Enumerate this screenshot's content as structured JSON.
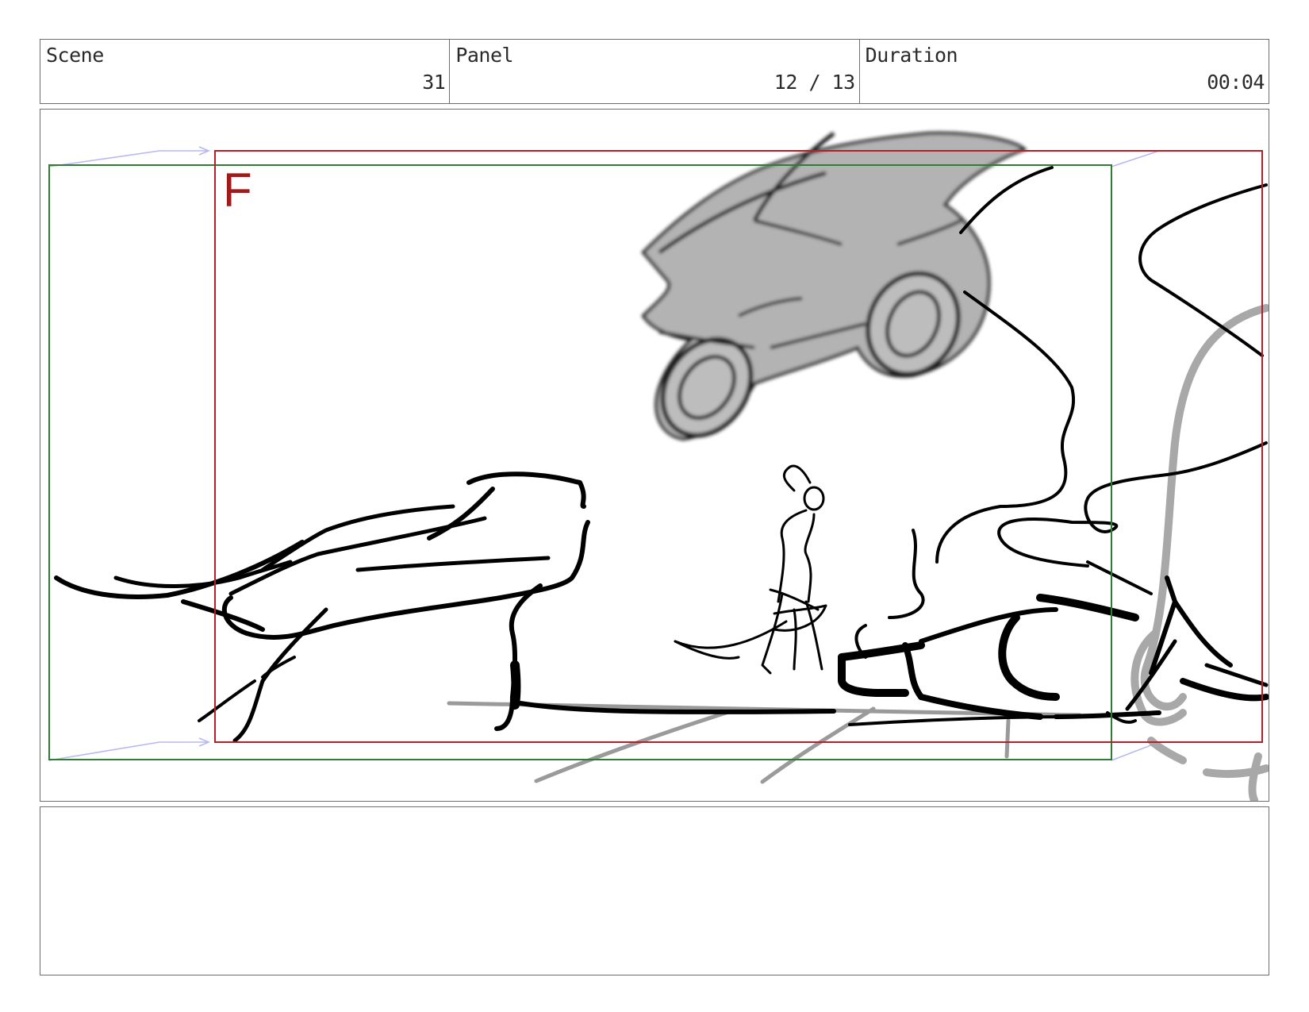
{
  "header": {
    "scene": {
      "label": "Scene",
      "value": "31"
    },
    "panel": {
      "label": "Panel",
      "value": "12 / 13"
    },
    "duration": {
      "label": "Duration",
      "value": "00:04"
    }
  },
  "frame": {
    "field_label": "F",
    "colors": {
      "field_frame": "#b3202a",
      "safe_frame": "#2e7d32",
      "camera_arrow": "#b8b8f0",
      "sketch": "#000000",
      "shade": "#b0b0b0"
    }
  },
  "notes": {
    "text": ""
  }
}
